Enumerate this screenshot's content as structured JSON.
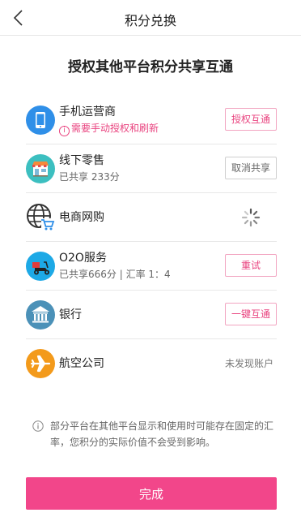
{
  "nav": {
    "title": "积分兑换",
    "back_icon": "chevron-left-icon"
  },
  "headline": "授权其他平台积分共享互通",
  "platforms": [
    {
      "name": "手机运营商",
      "icon": "mobile-phone-icon",
      "icon_color": "#2f8fe8",
      "subtitle": "需要手动授权和刷新",
      "subtitle_style": "warning",
      "action_label": "授权互通"
    },
    {
      "name": "线下零售",
      "icon": "store-icon",
      "icon_color": "#3cbfc0",
      "subtitle": "已共享 233分",
      "action_label": "取消共享"
    },
    {
      "name": "电商网购",
      "icon": "globe-cart-icon",
      "status": "loading"
    },
    {
      "name": "O2O服务",
      "icon": "delivery-scooter-icon",
      "icon_color": "#1da9e6",
      "subtitle": "已共享666分 | 汇率 1：4",
      "action_label": "重试"
    },
    {
      "name": "银行",
      "icon": "bank-icon",
      "icon_color": "#4b91b8",
      "action_label": "一键互通"
    },
    {
      "name": "航空公司",
      "icon": "airplane-icon",
      "icon_color": "#f39a1b",
      "status_text": "未发现账户"
    }
  ],
  "notice": "部分平台在其他平台显示和使用时可能存在固定的汇率，您积分的实际价值不会受到影响。",
  "done_label": "完成",
  "colors": {
    "accent": "#e9437f",
    "primary_button": "#f2468a"
  }
}
